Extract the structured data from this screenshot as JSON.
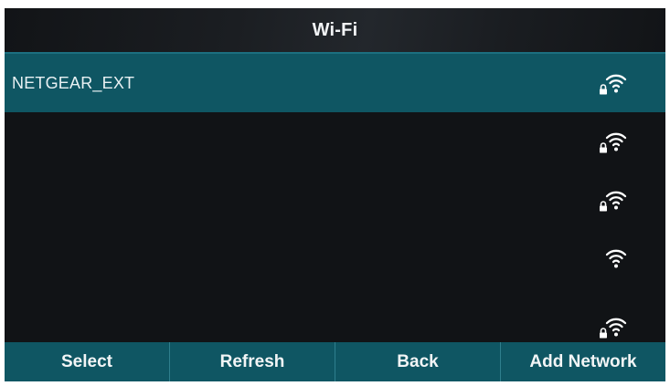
{
  "title": "Wi-Fi",
  "networks": [
    {
      "name": "NETGEAR_EXT",
      "icon": "wifi-locked-icon",
      "selected": true
    },
    {
      "name": "",
      "icon": "wifi-locked-icon",
      "selected": false
    },
    {
      "name": "",
      "icon": "wifi-locked-icon",
      "selected": false
    },
    {
      "name": "",
      "icon": "wifi-icon",
      "selected": false
    },
    {
      "name": "",
      "icon": "wifi-locked-icon",
      "selected": false
    }
  ],
  "softkeys": {
    "select": "Select",
    "refresh": "Refresh",
    "back": "Back",
    "add_network": "Add Network"
  },
  "colors": {
    "screen_background": "#111316",
    "selection_and_softkey_bar": "#0f5663",
    "accent_line": "#1c6f80",
    "text": "#f2f4f6"
  }
}
